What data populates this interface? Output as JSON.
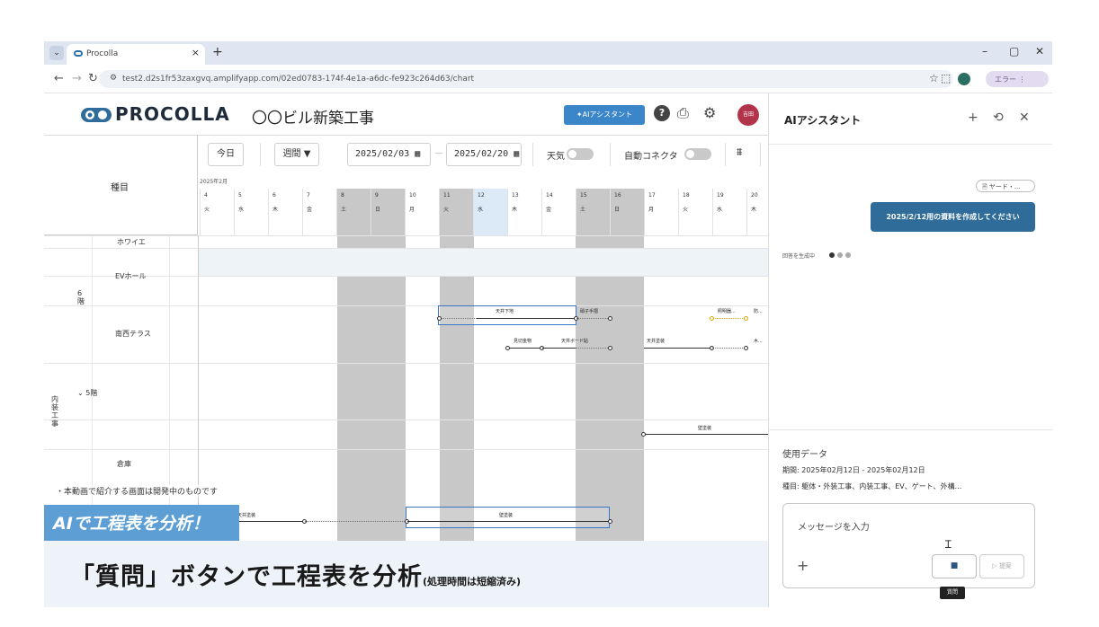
{
  "browser": {
    "tab_title": "Procolla",
    "tab_close": "×",
    "new_tab": "+",
    "url": "test2.d2s1fr53zaxgvq.amplifyapp.com/02ed0783-174f-4e1a-a6dc-fe923c264d63/chart",
    "error_label": "エラー",
    "window_controls": [
      "–",
      "▢",
      "✕"
    ]
  },
  "header": {
    "logo_text": "PROCOLLA",
    "project_title": "〇〇ビル新築工事",
    "ai_button_label": "✦AIアシスタント",
    "user_initials": "吉田"
  },
  "toolbar": {
    "today_label": "今日",
    "period_label": "週間 ▼",
    "date_from": "2025/02/03",
    "date_to": "2025/02/20",
    "range_separator": "—",
    "weather_label": "天気",
    "auto_connector_label": "自動コネクタ"
  },
  "grid": {
    "kind_header": "種目",
    "month_label": "2025年2月",
    "days": [
      {
        "d": "4",
        "w": "火"
      },
      {
        "d": "5",
        "w": "水"
      },
      {
        "d": "6",
        "w": "木"
      },
      {
        "d": "7",
        "w": "金"
      },
      {
        "d": "8",
        "w": "土"
      },
      {
        "d": "9",
        "w": "日"
      },
      {
        "d": "10",
        "w": "月"
      },
      {
        "d": "11",
        "w": "火"
      },
      {
        "d": "12",
        "w": "水"
      },
      {
        "d": "13",
        "w": "木"
      },
      {
        "d": "14",
        "w": "金"
      },
      {
        "d": "15",
        "w": "土"
      },
      {
        "d": "16",
        "w": "日"
      },
      {
        "d": "17",
        "w": "月"
      },
      {
        "d": "18",
        "w": "火"
      },
      {
        "d": "19",
        "w": "水"
      },
      {
        "d": "20",
        "w": "木"
      }
    ],
    "rows": {
      "howaie": "ホワイエ",
      "ev_hall": "EVホール",
      "floor6": "6\n階",
      "nansei_terrace": "南西テラス",
      "floor5": "5階",
      "naiso_koji": "内\n装\n工\n事",
      "soko": "倉庫"
    },
    "bars": {
      "tenjo_shitaji": "天井下地",
      "kenzai_tegata": "硝子手摺",
      "shomei": "照明器...",
      "bo": "防...",
      "mimikiri": "見切金物",
      "tenjo_board": "天井ボード貼",
      "tenjo_toso": "天井塗装",
      "ki": "木...",
      "kabe_toso": "壁塗装",
      "tenjo_toso2": "天井塗装",
      "kabe_toso2": "壁塗装"
    }
  },
  "overlay": {
    "note": "・本動画で紹介する画面は開発中のものです",
    "banner": "AIで工程表を分析！",
    "caption_main": "「質問」ボタンで工程表を分析",
    "caption_sub": "(処理時間は短縮済み)"
  },
  "assistant": {
    "title": "AIアシスタント",
    "chip_label": "🗎 ヤード・...",
    "user_message": "2025/2/12用の資料を作成してください",
    "generating": "回答を生成中",
    "used_data_title": "使用データ",
    "period_line": "期間:  2025年02月12日 - 2025年02月12日",
    "kinds_line": "種目:  躯体・外装工事、内装工事、EV、ゲート、外構...",
    "input_placeholder": "メッセージを入力",
    "send_label": "提案",
    "tooltip": "質問"
  },
  "colors": {
    "accent": "#3a86c8",
    "user_bubble": "#2f6c99",
    "weekend_shade": "#c8c8c8",
    "today_shade": "#dce9f7",
    "banner": "#5d9fd4"
  }
}
